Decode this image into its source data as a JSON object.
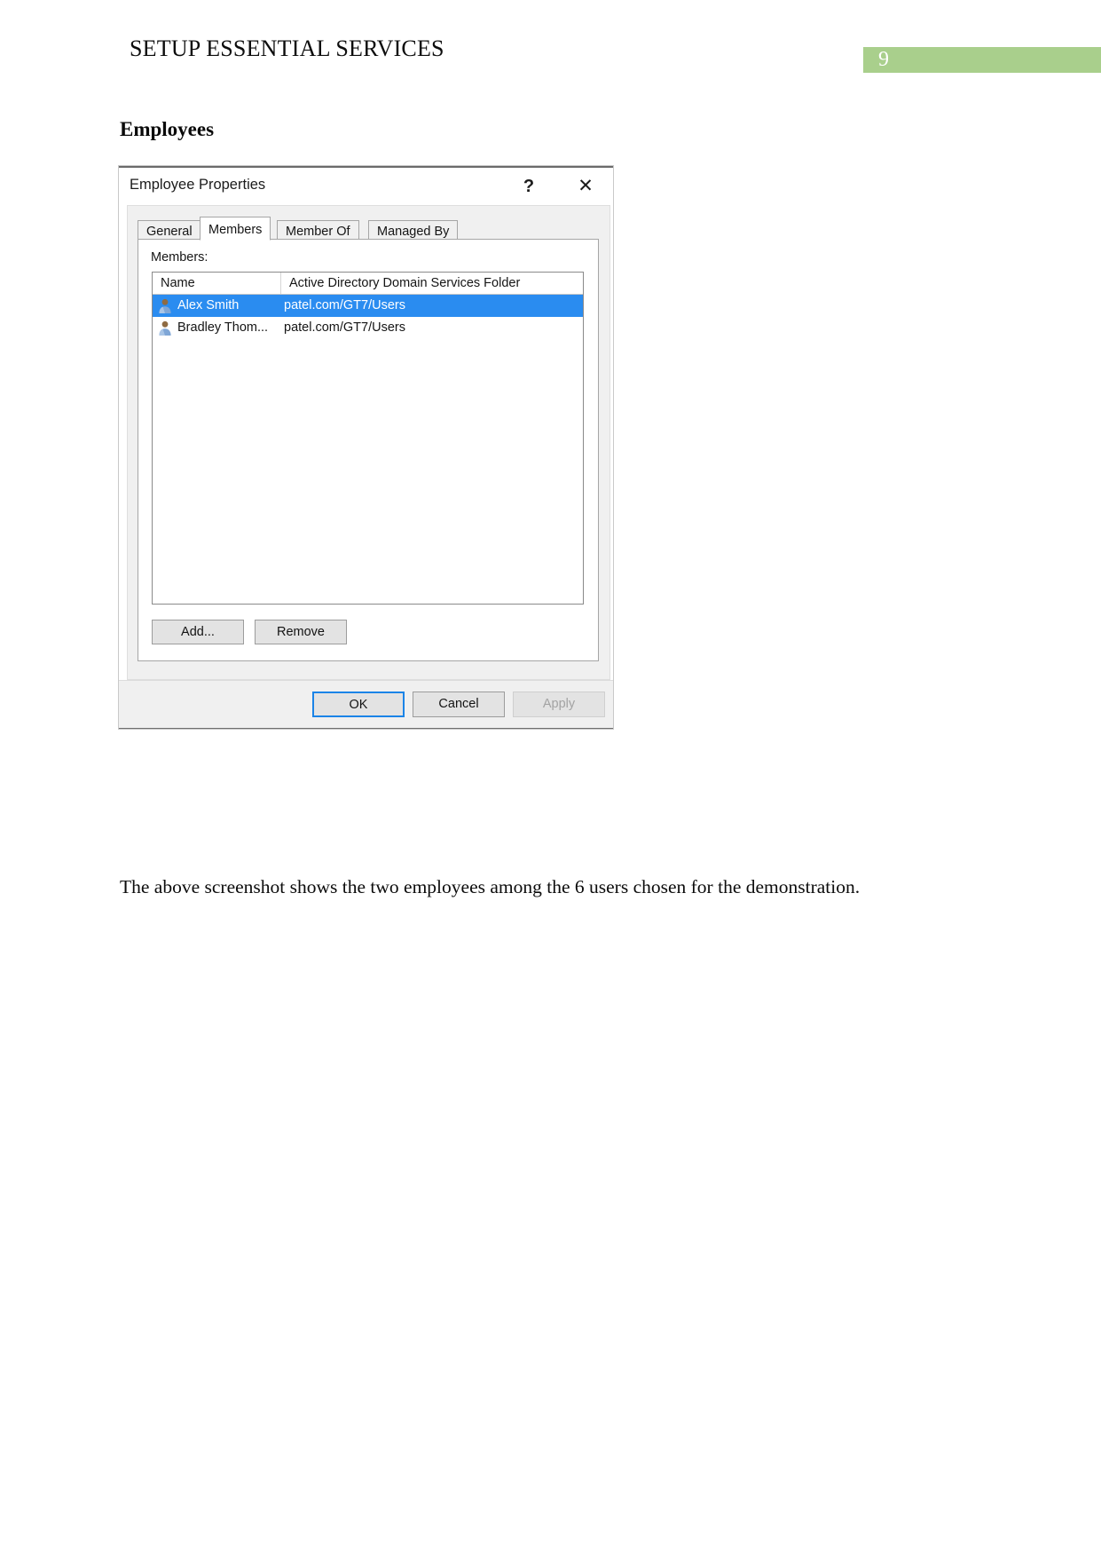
{
  "document": {
    "running_head": "SETUP ESSENTIAL SERVICES",
    "page_number": "9",
    "page_number_bg": "#a9cf8c",
    "section_heading": "Employees",
    "body_paragraph": "The above screenshot shows the two employees among the 6 users chosen for the demonstration."
  },
  "dialog": {
    "title": "Employee Properties",
    "help_icon": "?",
    "close_icon": "✕",
    "tabs": [
      {
        "label": "General",
        "active": false
      },
      {
        "label": "Members",
        "active": true
      },
      {
        "label": "Member Of",
        "active": false
      },
      {
        "label": "Managed By",
        "active": false
      }
    ],
    "members_label": "Members:",
    "list": {
      "columns": [
        "Name",
        "Active Directory Domain Services Folder"
      ],
      "rows": [
        {
          "name": "Alex Smith",
          "folder": "patel.com/GT7/Users",
          "selected": true
        },
        {
          "name": "Bradley Thom...",
          "folder": "patel.com/GT7/Users",
          "selected": false
        }
      ],
      "selection_color": "#2a8cf0"
    },
    "list_buttons": {
      "add": "Add...",
      "remove": "Remove"
    },
    "footer_buttons": {
      "ok": "OK",
      "cancel": "Cancel",
      "apply": "Apply",
      "focus_color": "#1b84e7",
      "apply_disabled": true
    }
  }
}
